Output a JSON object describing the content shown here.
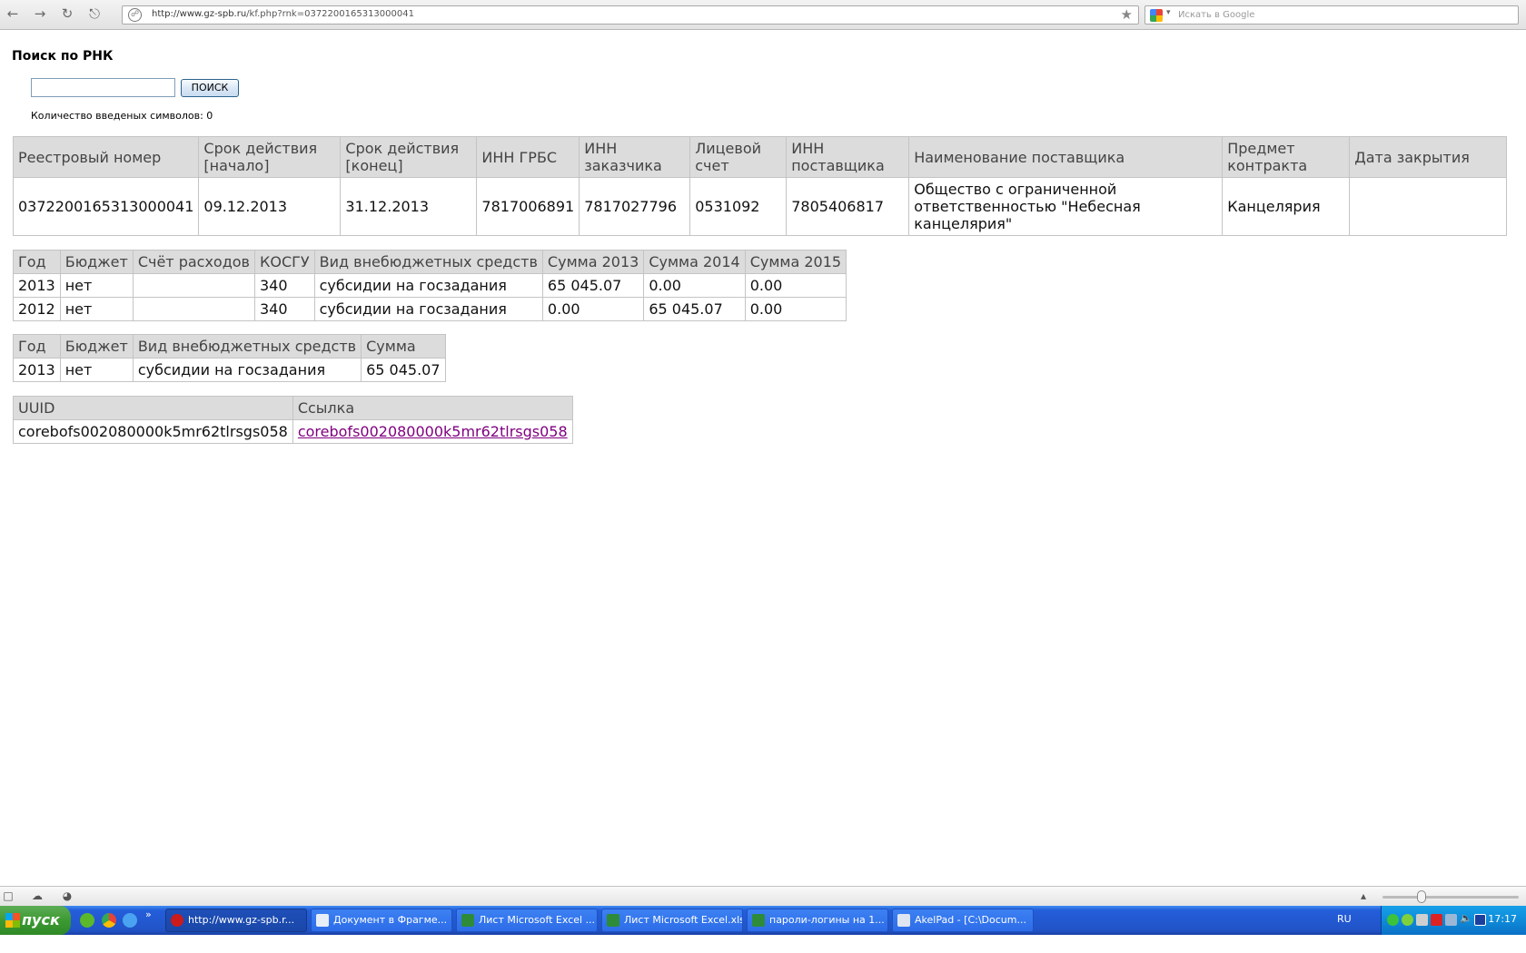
{
  "browser": {
    "url_host": "http://www.gz-spb.ru",
    "url_path": "/kf.php?rnk=0372200165313000041",
    "search_placeholder": "Искать в Google"
  },
  "page": {
    "title": "Поиск по РНК",
    "search_button": "ПОИСК",
    "counter": "Количество введеных символов: 0"
  },
  "contract_table": {
    "headers": [
      "Реестровый номер",
      "Срок действия [начало]",
      "Срок действия [конец]",
      "ИНН ГРБС",
      "ИНН заказчика",
      "Лицевой счет",
      "ИНН поставщика",
      "Наименование поставщика",
      "Предмет контракта",
      "Дата закрытия"
    ],
    "row": [
      "0372200165313000041",
      "09.12.2013",
      "31.12.2013",
      "7817006891",
      "7817027796",
      "0531092",
      "7805406817",
      "Общество с ограниченной ответственностью \"Небесная канцелярия\"",
      "Канцелярия",
      ""
    ]
  },
  "finance_table": {
    "headers": [
      "Год",
      "Бюджет",
      "Счёт расходов",
      "КОСГУ",
      "Вид внебюджетных средств",
      "Сумма 2013",
      "Сумма 2014",
      "Сумма 2015"
    ],
    "rows": [
      [
        "2013",
        "нет",
        "",
        "340",
        "субсидии на госзадания",
        "65 045.07",
        "0.00",
        "0.00"
      ],
      [
        "2012",
        "нет",
        "",
        "340",
        "субсидии на госзадания",
        "0.00",
        "65 045.07",
        "0.00"
      ]
    ]
  },
  "sum_table": {
    "headers": [
      "Год",
      "Бюджет",
      "Вид внебюджетных средств",
      "Сумма"
    ],
    "row": [
      "2013",
      "нет",
      "субсидии на госзадания",
      "65 045.07"
    ]
  },
  "uuid_table": {
    "headers": [
      "UUID",
      "Ссылка"
    ],
    "uuid": "corebofs002080000k5mr62tlrsgs058",
    "link": "corebofs002080000k5mr62tlrsgs058"
  },
  "taskbar": {
    "start_label": "пуск",
    "tasks": [
      "http://www.gz-spb.r...",
      "Документ в Фрагме...",
      "Лист Microsoft Excel ...",
      "Лист Microsoft Excel.xls",
      "пароли-логины на 1...",
      "AkelPad - [C:\\Docum..."
    ],
    "language": "RU",
    "clock": "17:17"
  }
}
